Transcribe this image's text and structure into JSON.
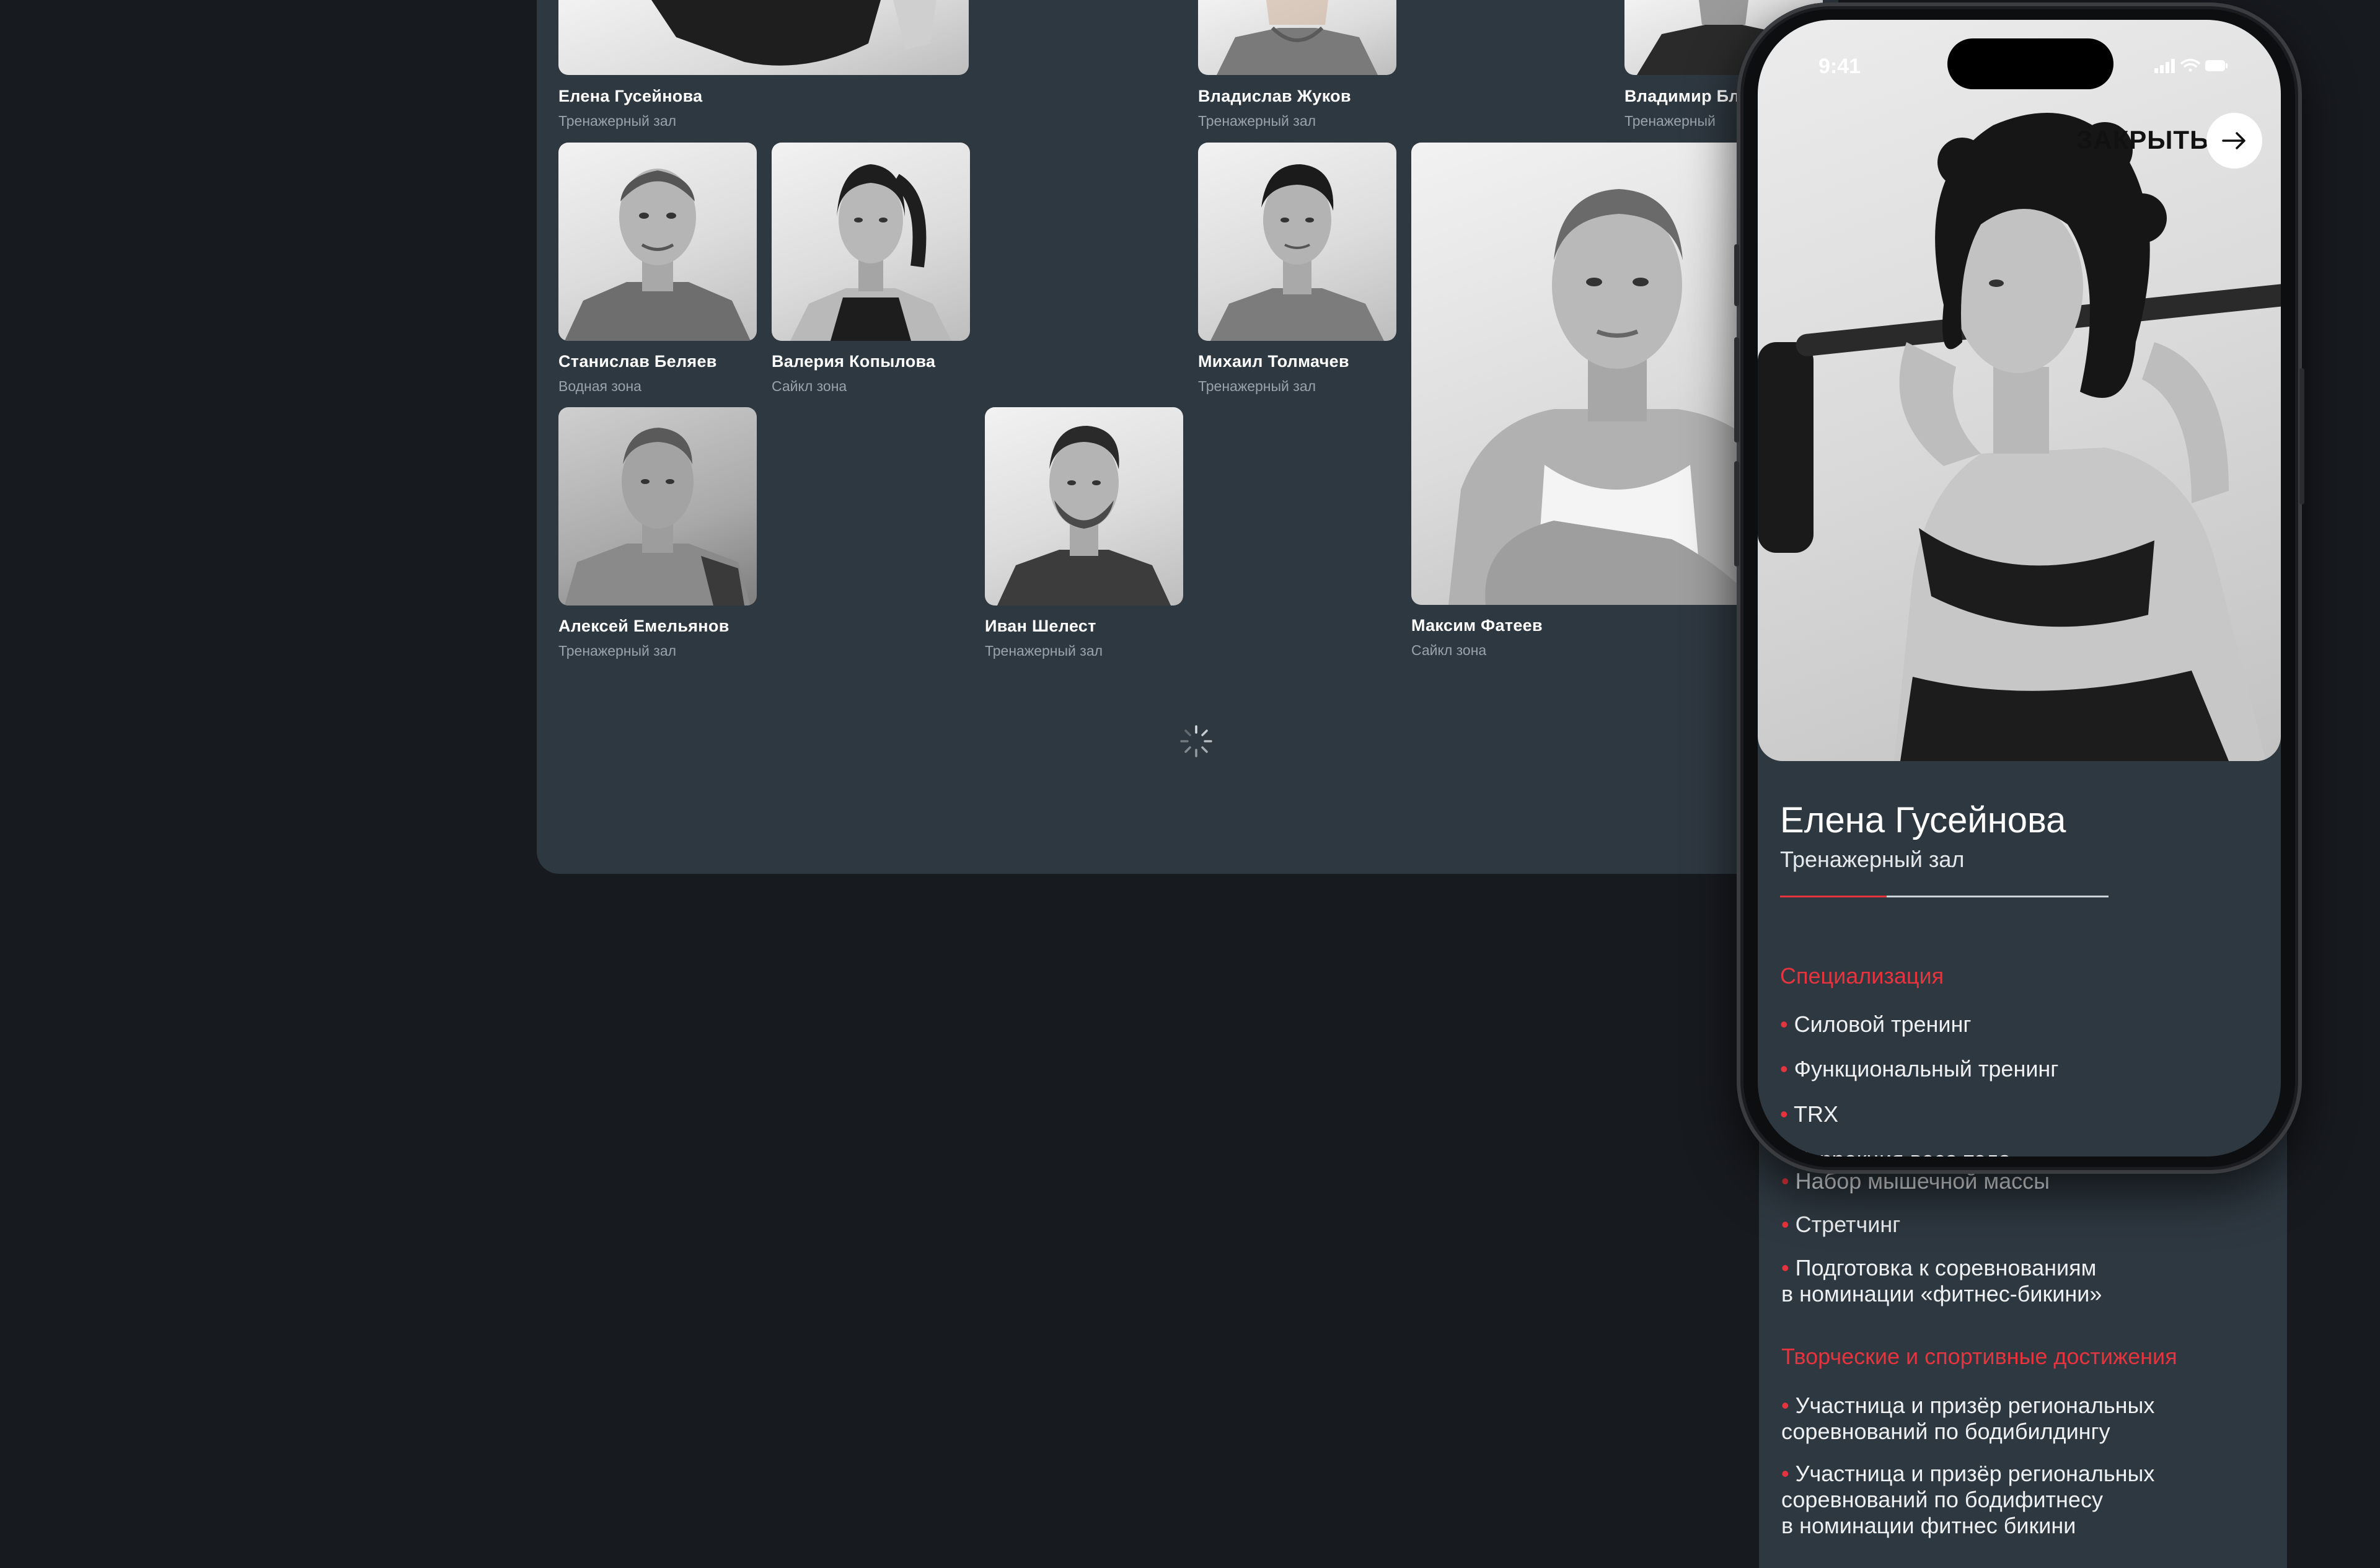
{
  "colors": {
    "accent": "#e5343d",
    "panel": "#2e3840",
    "background": "#171a1f"
  },
  "trainers": [
    {
      "name": "Елена Гусейнова",
      "zone": "Тренажерный зал"
    },
    {
      "name": "Владислав Жуков",
      "zone": "Тренажерный зал"
    },
    {
      "name": "Владимир Бл",
      "zone": "Тренажерный"
    },
    {
      "name": "Станислав Беляев",
      "zone": "Водная зона"
    },
    {
      "name": "Валерия Копылова",
      "zone": "Сайкл зона"
    },
    {
      "name": "Михаил Толмачев",
      "zone": "Тренажерный зал"
    },
    {
      "name": "Алексей Емельянов",
      "zone": "Тренажерный зал"
    },
    {
      "name": "Иван Шелест",
      "zone": "Тренажерный зал"
    },
    {
      "name": "Максим Фатеев",
      "zone": "Сайкл зона"
    }
  ],
  "phone": {
    "status": {
      "time": "9:41",
      "icons": [
        "signal-icon",
        "wifi-icon",
        "battery-icon"
      ]
    },
    "close_label": "ЗАКРЫТЬ",
    "close_icon": "arrow-right-icon",
    "profile": {
      "name": "Елена Гусейнова",
      "zone": "Тренажерный зал",
      "specialization_title": "Специализация",
      "specialization": [
        "Силовой тренинг",
        "Функциональный тренинг",
        "TRX",
        "Коррекция веса тела",
        "Набор мышечной массы",
        "Стретчинг",
        "Подготовка к соревнованиям",
        "в номинации «фитнес-бикини»"
      ],
      "achievements_title": "Творческие и спортивные достижения",
      "achievements": [
        "Участница и призёр региональных",
        "соревнований по бодибилдингу",
        "Участница и призёр региональных",
        "соревнований по бодифитнесу",
        "в номинации фитнес бикини"
      ]
    }
  },
  "loading_icon": "spinner-icon"
}
